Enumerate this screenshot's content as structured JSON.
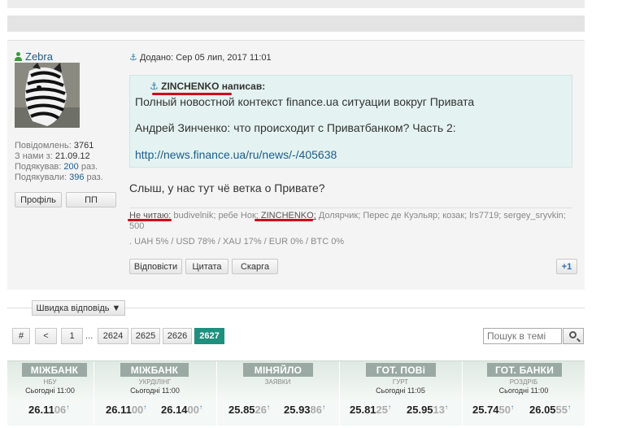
{
  "post": {
    "username": "Zebra",
    "stats": {
      "posts_label": "Повідомлень:",
      "posts": "3761",
      "joined_label": "З нами з:",
      "joined": "21.09.12",
      "thanked_label": "Подякував:",
      "thanked": "200",
      "thanked_unit": "раз.",
      "thanks_label": "Подякували:",
      "thanks": "396",
      "thanks_unit": "раз."
    },
    "profile_button": "Профіль",
    "pm_button": "ПП",
    "posted": "Додано: Сер 05 лип, 2017 11:01",
    "quote": {
      "author": "ZINCHENKO написав:",
      "line1": "Полный новостной контекст finance.ua ситуации вокруг Привата",
      "line2": "Андрей Зинченко: что происходит с Приватбанком? Часть 2:",
      "link": "http://news.finance.ua/ru/news/-/405638"
    },
    "message": "Слыш, у нас тут чё ветка о Привате?",
    "readers_label": "Не читаю:",
    "readers_a": "budivelnik; ребе Нок;",
    "readers_highlight": "ZINCHENKO;",
    "readers_b": "Долярчик; Перес де Куэльяр; козак; lrs7719; sergey_sryvkin;",
    "readers_c": "500",
    "rates": ". UAH 5% / USD 78% / XAU 17% / EUR 0% / BTC 0%",
    "reply_button": "Відповісти",
    "quote_button": "Цитата",
    "report_button": "Скарга",
    "plus_button": "+1"
  },
  "quick_reply": "Швидка відповідь ▼",
  "pagination": {
    "hash": "#",
    "prev": "<",
    "first": "1",
    "dots": "...",
    "pages": [
      "2624",
      "2625",
      "2626"
    ],
    "current": "2627"
  },
  "search": {
    "placeholder": "Пошук в темі"
  },
  "ticker": [
    {
      "title": "МІЖБАНК",
      "sub": "НБУ",
      "time": "Сьогодні 11:00",
      "values": [
        {
          "main": "26.11",
          "dim": "06"
        }
      ]
    },
    {
      "title": "МІЖБАНК",
      "sub": "УКРДІЛІНГ",
      "time": "Сьогодні 11:00",
      "values": [
        {
          "main": "26.11",
          "dim": "00"
        },
        {
          "main": "26.14",
          "dim": "00"
        }
      ]
    },
    {
      "title": "МІНЯЙЛО",
      "sub": "ЗАЯВКИ",
      "time": "",
      "values": [
        {
          "main": "25.85",
          "dim": "26"
        },
        {
          "main": "25.93",
          "dim": "86"
        }
      ]
    },
    {
      "title": "ГОТ. ПОВі",
      "sub": "ГУРТ",
      "time": "Сьогодні 11:05",
      "values": [
        {
          "main": "25.81",
          "dim": "25"
        },
        {
          "main": "25.95",
          "dim": "13"
        }
      ]
    },
    {
      "title": "ГОТ. БАНКИ",
      "sub": "РОЗДРІБ",
      "time": "Сьогодні 11:00",
      "values": [
        {
          "main": "25.74",
          "dim": "50"
        },
        {
          "main": "26.05",
          "dim": "55"
        }
      ]
    }
  ],
  "colors": {
    "accent": "#1f8f7e",
    "link": "#1d5c8a",
    "quote_bg": "#e4f3f1",
    "highlight": "#d0021b"
  }
}
